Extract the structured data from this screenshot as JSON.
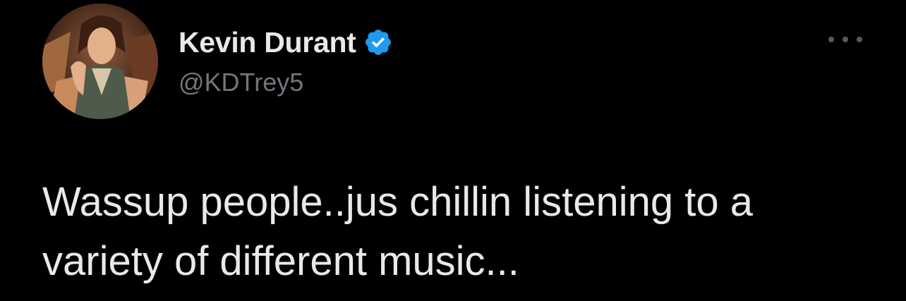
{
  "tweet": {
    "author": {
      "display_name": "Kevin Durant",
      "handle": "@KDTrey5",
      "verified": true,
      "avatar": "profile-avatar-animated-character"
    },
    "more_icon": "more-options-icon",
    "text_lines": [
      "Wassup people..jus chillin listening to a",
      "variety of different music..."
    ]
  },
  "colors": {
    "background": "#000000",
    "primary_text": "#e7e9ea",
    "secondary_text": "#71767b",
    "verified_blue": "#1d9bf0"
  }
}
